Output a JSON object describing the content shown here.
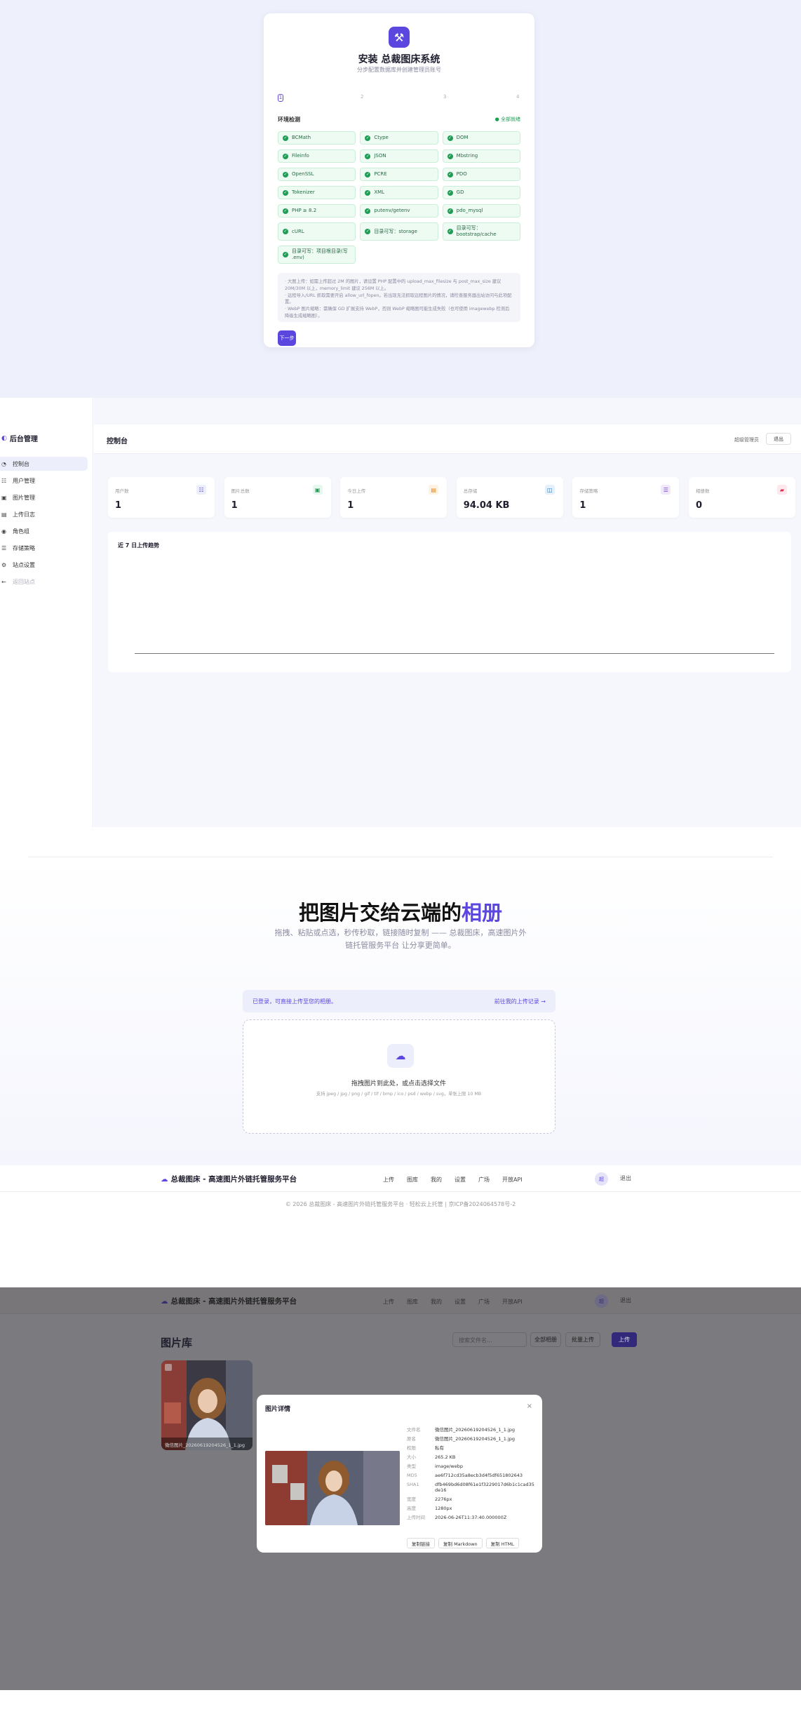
{
  "install": {
    "title": "安装 总裁图床系统",
    "subtitle": "分步配置数据库并创建管理员账号",
    "steps": [
      "1",
      "2",
      "3",
      "4"
    ],
    "env_heading": "环境检测",
    "env_status": "全部就绪",
    "checks": [
      "BCMath",
      "Ctype",
      "DOM",
      "Fileinfo",
      "JSON",
      "Mbstring",
      "OpenSSL",
      "PCRE",
      "PDO",
      "Tokenizer",
      "XML",
      "GD",
      "PHP ≥ 8.2",
      "putenv/getenv",
      "pdo_mysql",
      "cURL",
      "目录可写：storage",
      "目录可写：bootstrap/cache",
      "目录可写：项目根目录(写 .env)"
    ],
    "notes": [
      "· 大图上传：如需上传超过 2M 的图片，请设置 PHP 配置中的 upload_max_filesize 与 post_max_size 建议 20M/30M 以上，memory_limit 建议 256M 以上。",
      "· 远程导入/URL 抓取需要开启 allow_url_fopen。若出现无法抓取远程图片的情况，请检查服务器出站访问与此项配置。",
      "· WebP 图片缩略：需确保 GD 扩展支持 WebP，否则 WebP 缩略图可能生成失败（也可使用 imagewebp 检测后降级生成缩略图）。"
    ],
    "next_label": "下一步"
  },
  "admin": {
    "brand": "后台管理",
    "nav": [
      {
        "icon": "◔",
        "label": "控制台"
      },
      {
        "icon": "☷",
        "label": "用户管理"
      },
      {
        "icon": "▣",
        "label": "图片管理"
      },
      {
        "icon": "▤",
        "label": "上传日志"
      },
      {
        "icon": "◉",
        "label": "角色组"
      },
      {
        "icon": "☰",
        "label": "存储策略"
      },
      {
        "icon": "⚙",
        "label": "站点设置"
      },
      {
        "icon": "←",
        "label": "返回站点"
      }
    ],
    "page_title": "控制台",
    "link_label": "超级管理员",
    "logout_label": "退出",
    "stats": [
      {
        "label": "用户数",
        "value": "1",
        "icon": "☷",
        "color": "#5b47e0",
        "bg": "#eceefb"
      },
      {
        "label": "图片总数",
        "value": "1",
        "icon": "▣",
        "color": "#1f9d55",
        "bg": "#e6f7ee"
      },
      {
        "label": "今日上传",
        "value": "1",
        "icon": "▤",
        "color": "#e08a1e",
        "bg": "#fdf1e1"
      },
      {
        "label": "总存储",
        "value": "94.04 KB",
        "icon": "◫",
        "color": "#1a73c7",
        "bg": "#e4f0fb"
      },
      {
        "label": "存储策略",
        "value": "1",
        "icon": "☰",
        "color": "#7a3fc9",
        "bg": "#f0e8fb"
      },
      {
        "label": "相册数",
        "value": "0",
        "icon": "▰",
        "color": "#d9304f",
        "bg": "#fce7ec"
      }
    ],
    "chart_title": "近 7 日上传趋势"
  },
  "upload": {
    "hero_prefix": "把图片交给云端的",
    "hero_highlight": "相册",
    "subtitle": "拖拽、粘贴或点选，秒传秒取，链接随时复制 —— 总裁图床，高速图片外链托管服务平台 让分享更简单。",
    "banner_left": "已登录，可直接上传至您的相册。",
    "banner_right": "前往我的上传记录 →",
    "drop_title": "拖拽图片到此处，或点击选择文件",
    "drop_hint": "支持 jpeg / jpg / png / gif / tif / bmp / ico / psd / webp / svg，单张上限 10 MB",
    "brand": "总裁图床 - 高速图片外链托管服务平台",
    "nav": [
      "上传",
      "图库",
      "我的",
      "设置",
      "广场",
      "开放API"
    ],
    "avatar": "超",
    "logout": "退出",
    "footer": "© 2026 总裁图床 - 高速图片外链托管服务平台 · 轻松云上托管 | 京ICP备2024064578号-2"
  },
  "library": {
    "title": "图片库",
    "search_placeholder": "搜索文件名...",
    "btn_album": "全部相册",
    "btn_batch": "批量上传",
    "btn_upload": "上传",
    "thumb_caption": "微信图片_20260619204526_1_1.jpg",
    "modal": {
      "title": "图片详情",
      "close": "×",
      "rows": [
        {
          "k": "文件名",
          "v": "微信图片_20260619204526_1_1.jpg"
        },
        {
          "k": "原名",
          "v": "微信图片_20260619204526_1_1.jpg"
        },
        {
          "k": "权限",
          "v": "私有"
        },
        {
          "k": "大小",
          "v": "265.2 KB"
        },
        {
          "k": "类型",
          "v": "image/webp"
        },
        {
          "k": "MD5",
          "v": "ae6f712cd35a8ecb3d4f5df651802643"
        },
        {
          "k": "SHA1",
          "v": "dfb469bd6d08f61e1f3229017d6b1c1cad35de16"
        },
        {
          "k": "宽度",
          "v": "2276px"
        },
        {
          "k": "高度",
          "v": "1280px"
        },
        {
          "k": "上传时间",
          "v": "2026-06-26T11:37:40.000000Z"
        }
      ],
      "copy_buttons": [
        "复制链接",
        "复制 Markdown",
        "复制 HTML"
      ]
    }
  }
}
